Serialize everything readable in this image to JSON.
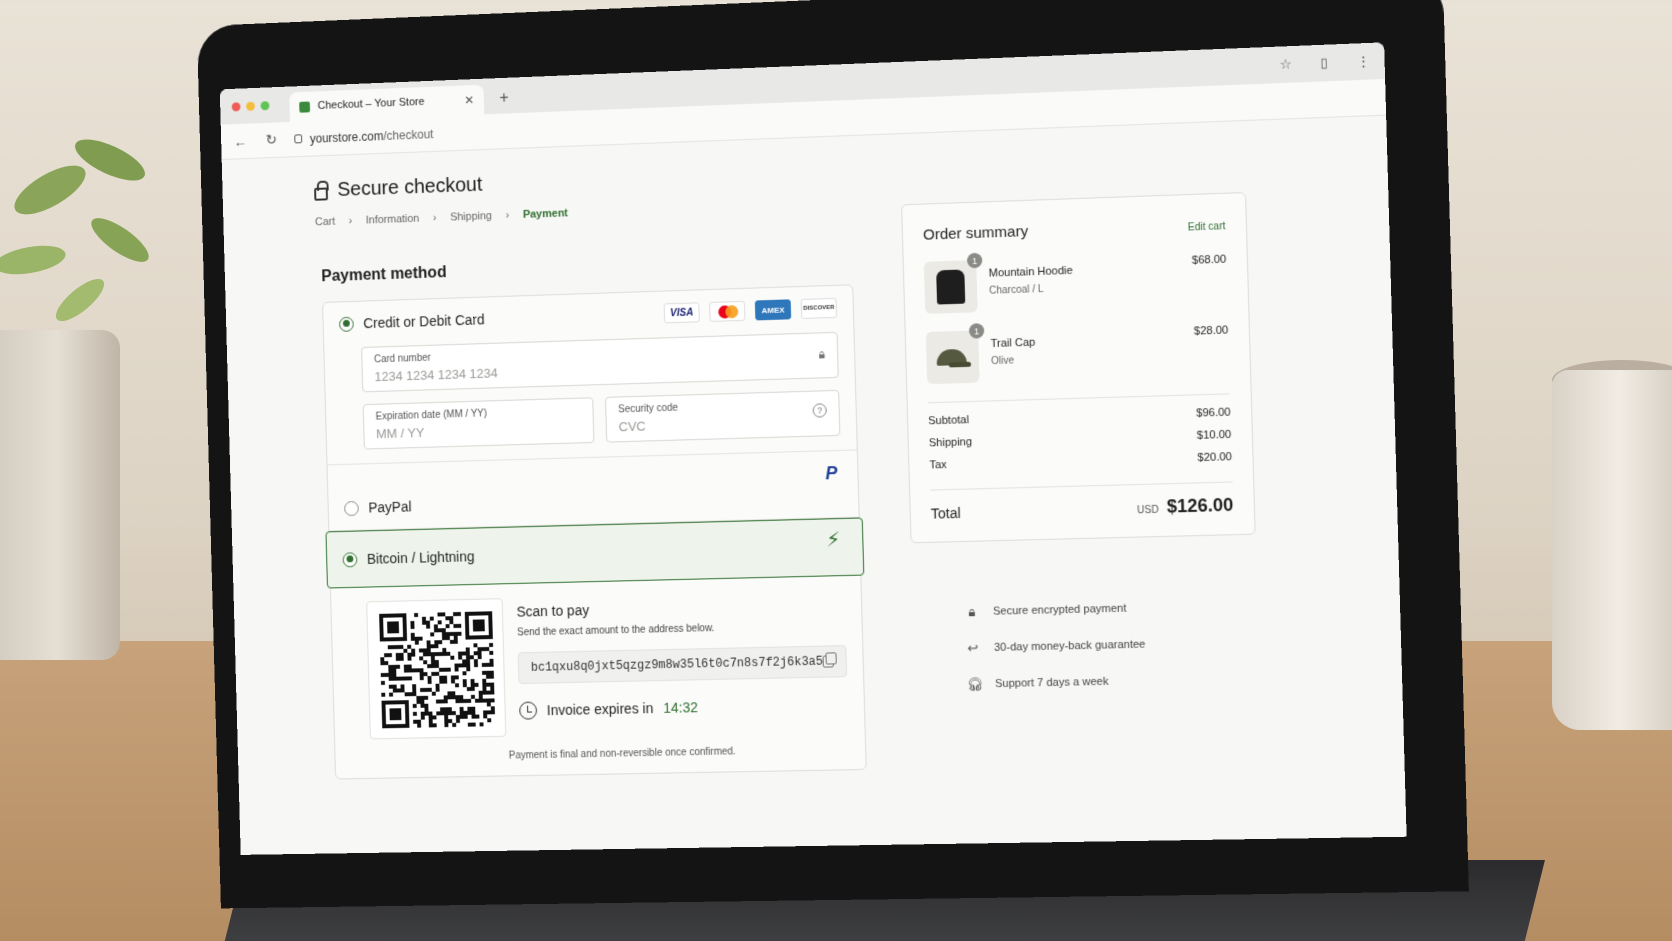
{
  "browser": {
    "tab_title": "Checkout – Your Store",
    "url_domain": "yourstore.com",
    "url_path": "/checkout"
  },
  "checkout": {
    "title": "Secure checkout",
    "breadcrumb": [
      "Cart",
      "Information",
      "Shipping",
      "Payment"
    ],
    "payment_heading": "Payment method"
  },
  "card": {
    "label": "Credit or Debit Card",
    "brands": [
      "VISA",
      "AMEX",
      "DISCOVER"
    ],
    "number_label": "Card number",
    "number_placeholder": "1234 1234 1234 1234",
    "expiry_label": "Expiration date (MM / YY)",
    "expiry_placeholder": "MM / YY",
    "cvc_label": "Security code",
    "cvc_placeholder": "CVC"
  },
  "paypal": {
    "label": "PayPal",
    "logo": "P"
  },
  "bitcoin": {
    "label": "Bitcoin / Lightning",
    "scan_title": "Scan to pay",
    "scan_sub": "Send the exact amount to the address below.",
    "address": "bc1qxu8q0jxt5qzgz9m8w35l6t0c7n8s7f2j6k3a5",
    "expires_label": "Invoice expires in",
    "expires_time": "14:32",
    "note": "Payment is final and non-reversible once confirmed."
  },
  "summary": {
    "title": "Order summary",
    "edit_label": "Edit cart",
    "items": [
      {
        "qty": "1",
        "name": "Mountain Hoodie",
        "variant": "Charcoal / L",
        "price": "$68.00"
      },
      {
        "qty": "1",
        "name": "Trail Cap",
        "variant": "Olive",
        "price": "$28.00"
      }
    ],
    "subtotal_label": "Subtotal",
    "subtotal": "$96.00",
    "shipping_label": "Shipping",
    "shipping": "$10.00",
    "tax_label": "Tax",
    "tax": "$20.00",
    "total_label": "Total",
    "currency": "USD",
    "total": "$126.00"
  },
  "perks": [
    "Secure encrypted payment",
    "30-day money-back guarantee",
    "Support 7 days a week"
  ],
  "colors": {
    "accent": "#2f6f2f",
    "selected_bg": "#eef4ec"
  },
  "icons": [
    "lock-icon",
    "chevron-right-icon",
    "help-icon",
    "paypal-icon",
    "lightning-icon",
    "copy-icon",
    "clock-icon",
    "return-icon",
    "headset-icon"
  ]
}
